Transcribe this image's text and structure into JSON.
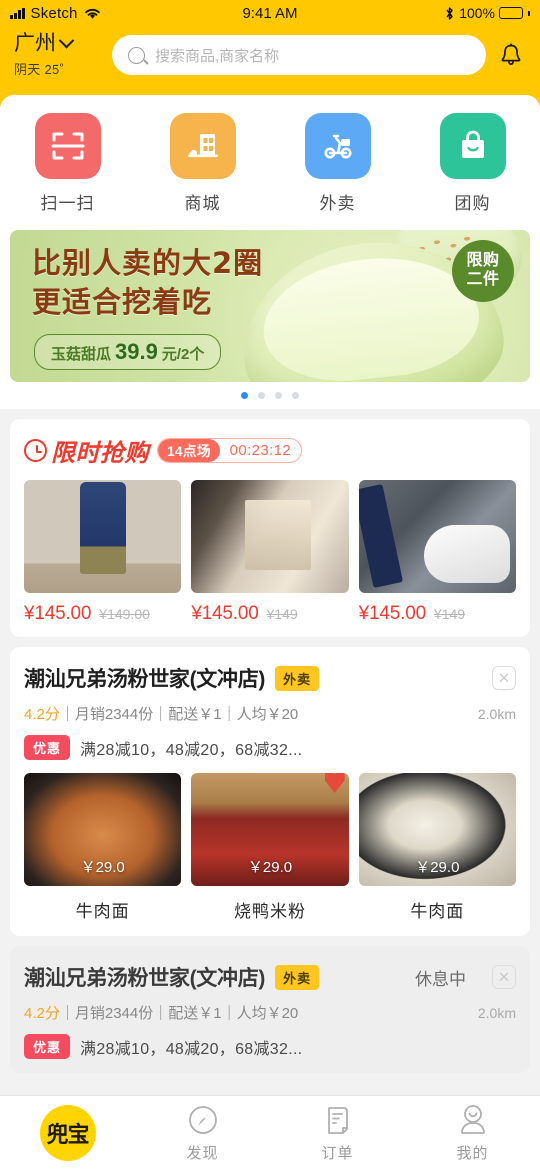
{
  "statusbar": {
    "carrier": "Sketch",
    "time": "9:41 AM",
    "battery_pct": "100%",
    "wifi_icon": "wifi-icon",
    "bluetooth_icon": "bluetooth-icon",
    "signal_icon": "signal-bars-icon",
    "battery_icon": "battery-full-icon"
  },
  "header": {
    "city": "广州",
    "weather": "阴天 25˚",
    "search_placeholder": "搜索商品,商家名称",
    "search_icon": "search-icon",
    "bell_icon": "bell-icon",
    "chevron_icon": "chevron-down-icon",
    "bg_color": "#ffc800"
  },
  "categories": [
    {
      "label": "扫一扫",
      "icon": "scan-qr-icon",
      "color": "#f46a6a"
    },
    {
      "label": "商城",
      "icon": "store-building-icon",
      "color": "#f7b34c"
    },
    {
      "label": "外卖",
      "icon": "delivery-scooter-icon",
      "color": "#5da9f5"
    },
    {
      "label": "团购",
      "icon": "shopping-bag-icon",
      "color": "#2ec49a"
    }
  ],
  "banner": {
    "line1": "比别人卖的大2圈",
    "line2": "更适合挖着吃",
    "product_name": "玉菇甜瓜",
    "price": "39.9",
    "price_unit": "元/2个",
    "limit_badge_line1": "限购",
    "limit_badge_line2": "二件",
    "dots_total": 4,
    "dots_active": 1,
    "active_dot_color": "#2b8cf0"
  },
  "flash_sale": {
    "title": "限时抢购",
    "clock_icon": "clock-icon",
    "session": "14点场",
    "countdown": "00:23:12",
    "accent_color": "#ef3b2f",
    "items": [
      {
        "image": "navy-cargo-pants-photo",
        "price": "¥145.00",
        "original_price": "¥149.00"
      },
      {
        "image": "walk-in-closet-photo",
        "price": "¥145.00",
        "original_price": "¥149"
      },
      {
        "image": "white-sneakers-photo",
        "price": "¥145.00",
        "original_price": "¥149"
      }
    ]
  },
  "shops": [
    {
      "name": "潮汕兄弟汤粉世家(文冲店)",
      "tag": "外卖",
      "rating": "4.2分",
      "meta": "｜月销2344份｜配送￥1｜人均￥20",
      "distance": "2.0km",
      "promo_tag": "优惠",
      "promo_text": "满28减10，48减20，68减32...",
      "status": "",
      "close_icon": "close-icon",
      "dishes": [
        {
          "name": "牛肉面",
          "price": "￥29.0",
          "image": "beef-noodle-soup-photo"
        },
        {
          "name": "烧鸭米粉",
          "price": "￥29.0",
          "image": "roast-duck-rice-noodle-photo",
          "badge": "heart-icon"
        },
        {
          "name": "牛肉面",
          "price": "￥29.0",
          "image": "beef-noodle-bowl-photo"
        }
      ]
    },
    {
      "name": "潮汕兄弟汤粉世家(文冲店)",
      "tag": "外卖",
      "rating": "4.2分",
      "meta": "｜月销2344份｜配送￥1｜人均￥20",
      "distance": "2.0km",
      "promo_tag": "优惠",
      "promo_text": "满28减10，48减20，68减32...",
      "status": "休息中",
      "close_icon": "close-icon",
      "dishes": []
    }
  ],
  "tabbar": {
    "logo": "兜宝",
    "items": [
      {
        "label": "",
        "icon": "app-logo-icon"
      },
      {
        "label": "发现",
        "icon": "compass-icon"
      },
      {
        "label": "订单",
        "icon": "order-document-icon"
      },
      {
        "label": "我的",
        "icon": "user-profile-icon"
      }
    ]
  }
}
